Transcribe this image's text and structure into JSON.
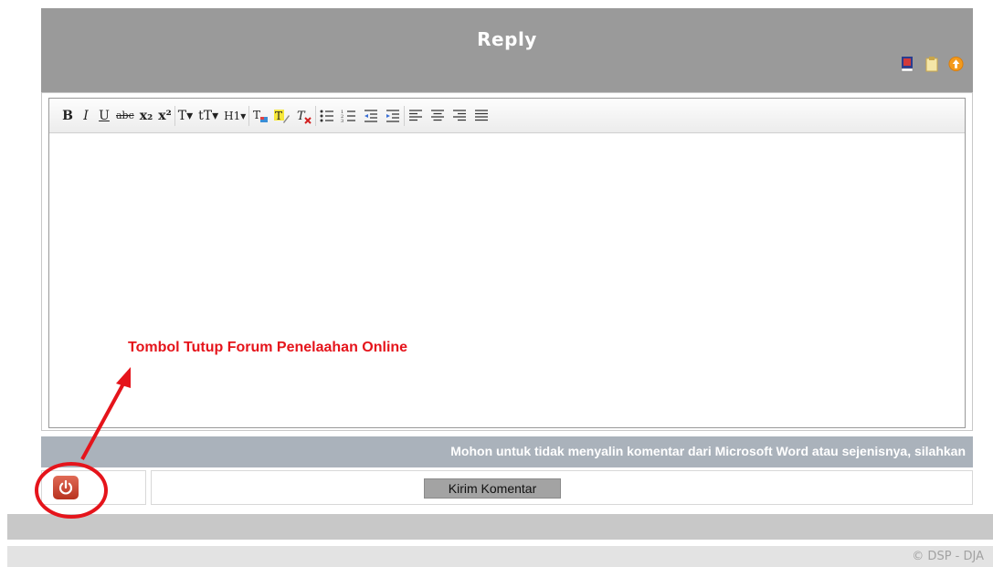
{
  "reply": {
    "title": "Reply",
    "icons": [
      "book-icon",
      "clipboard-icon",
      "scroll-up-icon"
    ]
  },
  "toolbar": {
    "items": [
      {
        "name": "bold",
        "label": "B"
      },
      {
        "name": "italic",
        "label": "I"
      },
      {
        "name": "underline",
        "label": "U"
      },
      {
        "name": "strikethrough",
        "label": "abc"
      },
      {
        "name": "subscript",
        "label": "x₂"
      },
      {
        "name": "superscript",
        "label": "x²"
      },
      {
        "name": "font-size",
        "label": "T▾"
      },
      {
        "name": "font-family",
        "label": "tT▾"
      },
      {
        "name": "heading",
        "label": "H1▾"
      },
      {
        "name": "text-color",
        "label": "T"
      },
      {
        "name": "highlight",
        "label": "T"
      },
      {
        "name": "remove-format",
        "label": "T"
      },
      {
        "name": "unordered-list",
        "label": "☰"
      },
      {
        "name": "ordered-list",
        "label": "☰"
      },
      {
        "name": "outdent",
        "label": "⇤"
      },
      {
        "name": "indent",
        "label": "⇥"
      },
      {
        "name": "align-left",
        "label": "≡"
      },
      {
        "name": "align-center",
        "label": "≡"
      },
      {
        "name": "align-right",
        "label": "≡"
      },
      {
        "name": "align-justify",
        "label": "≡"
      }
    ]
  },
  "annotation": {
    "text": "Tombol Tutup Forum Penelaahan Online",
    "color": "#e5141b"
  },
  "notice": {
    "text": "Mohon untuk tidak menyalin komentar dari Microsoft Word atau sejenisnya, silahkan"
  },
  "actions": {
    "submit_label": "Kirim Komentar",
    "power_icon": "power-icon"
  },
  "footer": {
    "copyright": "© DSP - DJA"
  },
  "colors": {
    "header_bg": "#9a9a9a",
    "notice_bg": "#aab2bb",
    "power_button": "#c9402b"
  }
}
